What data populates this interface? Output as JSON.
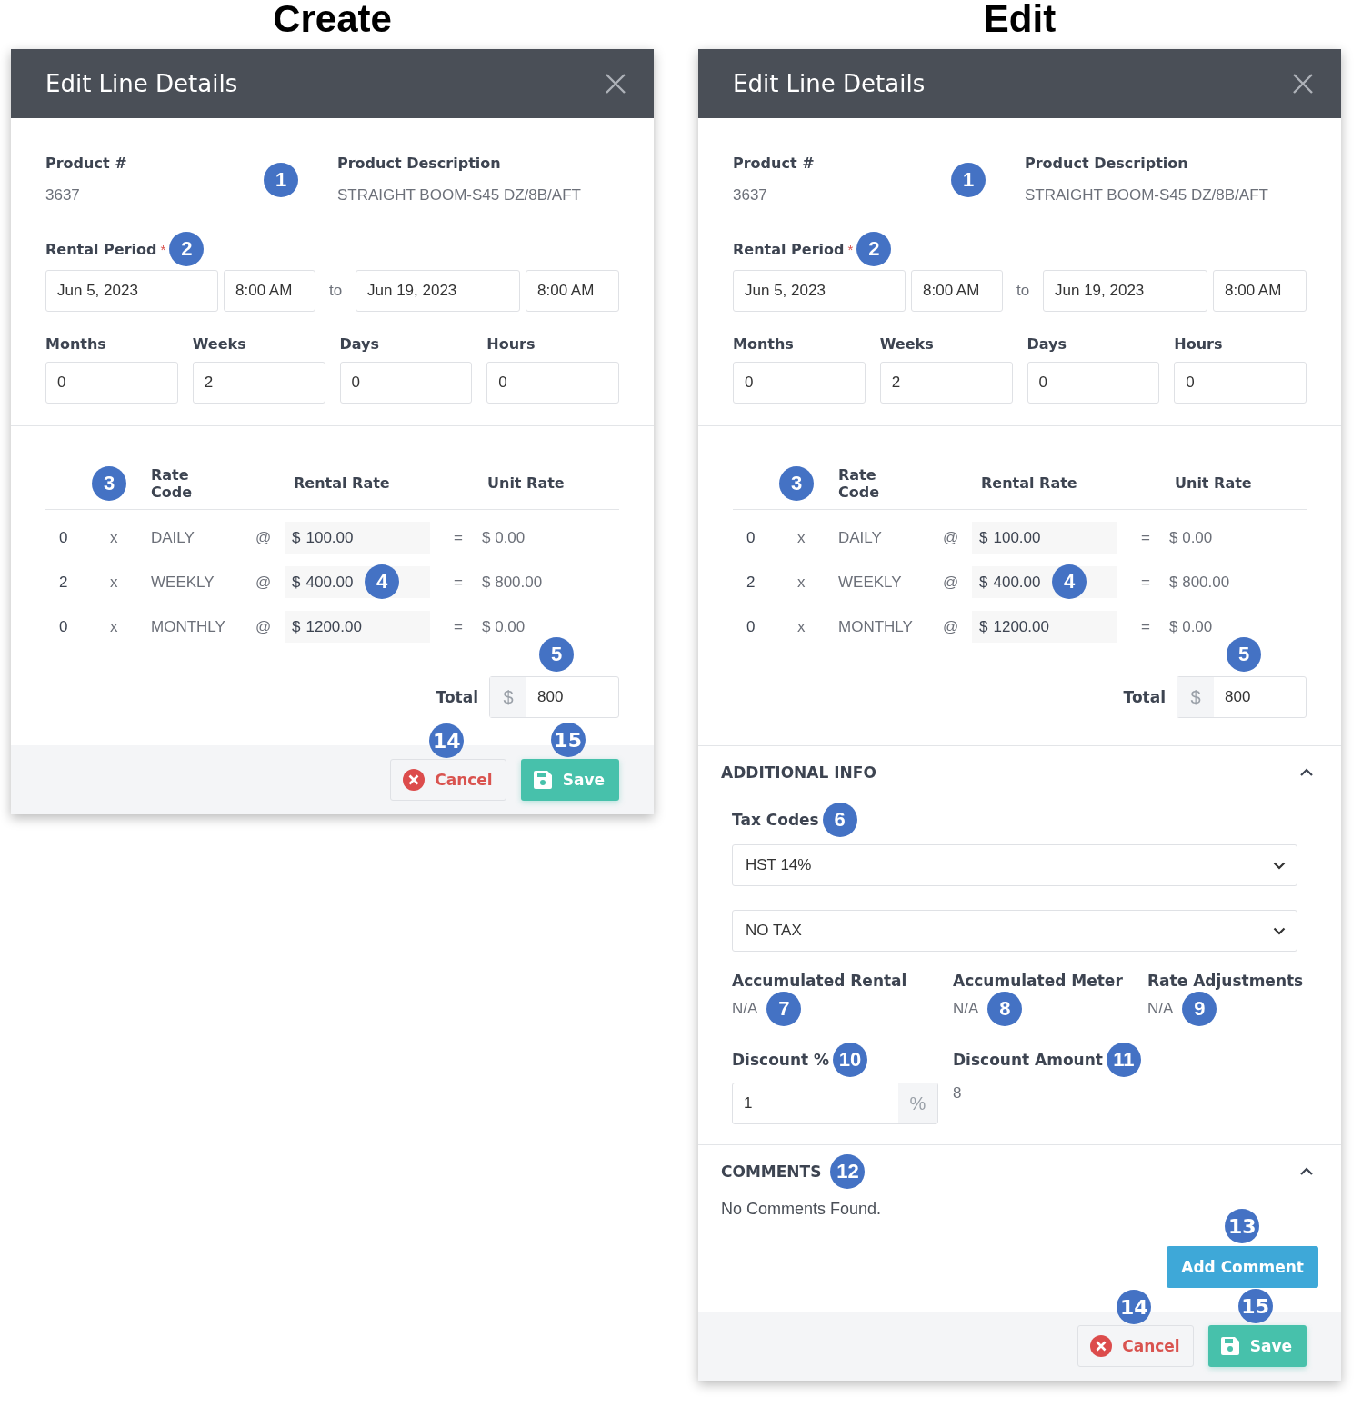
{
  "panels": [
    {
      "heading": "Create",
      "dialog": {
        "title": "Edit Line Details",
        "product": {
          "label": "Product #",
          "value": "3637",
          "badge": "1"
        },
        "description": {
          "label": "Product Description",
          "value": "STRAIGHT BOOM-S45 DZ/8B/AFT"
        },
        "rental_period": {
          "label": "Rental Period",
          "required": "*",
          "badge": "2",
          "start_date": "Jun 5, 2023",
          "start_time": "8:00 AM",
          "separator": "to",
          "end_date": "Jun 19, 2023",
          "end_time": "8:00 AM"
        },
        "durations": [
          {
            "label": "Months",
            "value": "0"
          },
          {
            "label": "Weeks",
            "value": "2"
          },
          {
            "label": "Days",
            "value": "0"
          },
          {
            "label": "Hours",
            "value": "0"
          }
        ],
        "rates": {
          "badge": "3",
          "columns": [
            "Rate Code",
            "Rental Rate",
            "Unit Rate"
          ],
          "rows": [
            {
              "qty": "0",
              "times": "x",
              "code": "DAILY",
              "at": "@",
              "currency": "$",
              "rate": "100.00",
              "equals": "=",
              "unit_rate": "$ 0.00"
            },
            {
              "qty": "2",
              "times": "x",
              "code": "WEEKLY",
              "at": "@",
              "currency": "$",
              "rate": "400.00",
              "badge": "4",
              "equals": "=",
              "unit_rate": "$ 800.00"
            },
            {
              "qty": "0",
              "times": "x",
              "code": "MONTHLY",
              "at": "@",
              "currency": "$",
              "rate": "1200.00",
              "equals": "=",
              "unit_rate": "$ 0.00"
            }
          ]
        },
        "total": {
          "label": "Total",
          "currency": "$",
          "value": "800",
          "badge": "5"
        },
        "buttons": {
          "cancel": {
            "label": "Cancel",
            "badge": "14"
          },
          "save": {
            "label": "Save",
            "badge": "15"
          }
        }
      }
    },
    {
      "heading": "Edit",
      "dialog": {
        "title": "Edit Line Details",
        "product": {
          "label": "Product #",
          "value": "3637",
          "badge": "1"
        },
        "description": {
          "label": "Product Description",
          "value": "STRAIGHT BOOM-S45 DZ/8B/AFT"
        },
        "rental_period": {
          "label": "Rental Period",
          "required": "*",
          "badge": "2",
          "start_date": "Jun 5, 2023",
          "start_time": "8:00 AM",
          "separator": "to",
          "end_date": "Jun 19, 2023",
          "end_time": "8:00 AM"
        },
        "durations": [
          {
            "label": "Months",
            "value": "0"
          },
          {
            "label": "Weeks",
            "value": "2"
          },
          {
            "label": "Days",
            "value": "0"
          },
          {
            "label": "Hours",
            "value": "0"
          }
        ],
        "rates": {
          "badge": "3",
          "columns": [
            "Rate Code",
            "Rental Rate",
            "Unit Rate"
          ],
          "rows": [
            {
              "qty": "0",
              "times": "x",
              "code": "DAILY",
              "at": "@",
              "currency": "$",
              "rate": "100.00",
              "equals": "=",
              "unit_rate": "$ 0.00"
            },
            {
              "qty": "2",
              "times": "x",
              "code": "WEEKLY",
              "at": "@",
              "currency": "$",
              "rate": "400.00",
              "badge": "4",
              "equals": "=",
              "unit_rate": "$ 800.00"
            },
            {
              "qty": "0",
              "times": "x",
              "code": "MONTHLY",
              "at": "@",
              "currency": "$",
              "rate": "1200.00",
              "equals": "=",
              "unit_rate": "$ 0.00"
            }
          ]
        },
        "total": {
          "label": "Total",
          "currency": "$",
          "value": "800",
          "badge": "5"
        },
        "additional_info": {
          "title": "ADDITIONAL INFO",
          "expanded": true,
          "tax_codes": {
            "label": "Tax Codes",
            "badge": "6",
            "selects": [
              "HST 14%",
              "NO TAX"
            ]
          },
          "stats": [
            {
              "label": "Accumulated Rental",
              "value": "N/A",
              "badge": "7"
            },
            {
              "label": "Accumulated Meter",
              "value": "N/A",
              "badge": "8"
            },
            {
              "label": "Rate Adjustments",
              "value": "N/A",
              "badge": "9"
            }
          ],
          "discount_percent": {
            "label": "Discount %",
            "badge": "10",
            "value": "1",
            "suffix": "%"
          },
          "discount_amount": {
            "label": "Discount Amount",
            "badge": "11",
            "value": "8"
          }
        },
        "comments": {
          "title": "COMMENTS",
          "badge": "12",
          "expanded": true,
          "empty_text": "No Comments Found.",
          "add_button": {
            "label": "Add Comment",
            "badge": "13"
          }
        },
        "buttons": {
          "cancel": {
            "label": "Cancel",
            "badge": "14"
          },
          "save": {
            "label": "Save",
            "badge": "15"
          }
        }
      }
    }
  ]
}
